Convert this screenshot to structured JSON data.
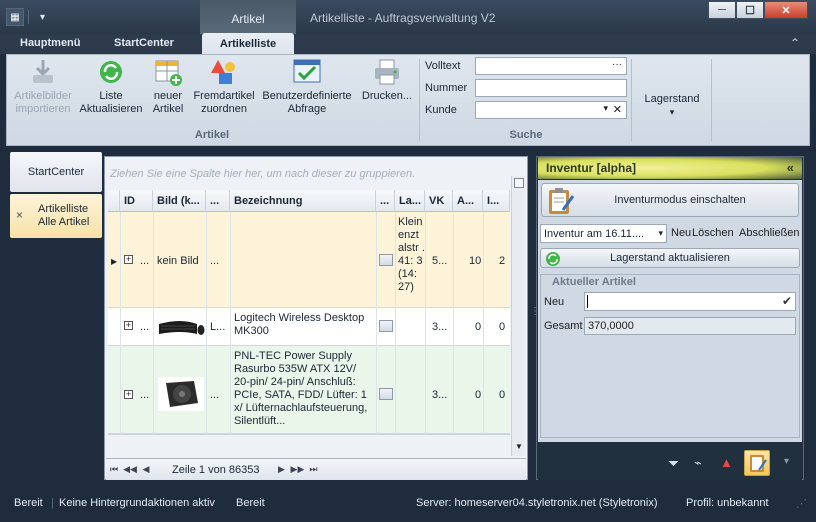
{
  "window": {
    "title": "Artikelliste - Auftragsverwaltung V2",
    "context_tab": "Artikel"
  },
  "tabs": [
    {
      "label": "Hauptmenü"
    },
    {
      "label": "StartCenter"
    },
    {
      "label": "Artikelliste"
    }
  ],
  "ribbon": {
    "groups": {
      "artikel": "Artikel",
      "suche": "Suche"
    },
    "buttons": [
      {
        "label": "Artikelbilder importieren",
        "icon": "import-images-icon",
        "enabled": false
      },
      {
        "label": "Liste Aktualisieren",
        "icon": "refresh-list-icon",
        "enabled": true
      },
      {
        "label": "neuer Artikel",
        "icon": "new-article-icon",
        "enabled": true
      },
      {
        "label": "Fremdartikel zuordnen",
        "icon": "assign-foreign-article-icon",
        "enabled": true
      },
      {
        "label": "Benutzerdefinierte Abfrage",
        "icon": "custom-query-icon",
        "enabled": true
      },
      {
        "label": "Drucken...",
        "icon": "printer-icon",
        "enabled": true
      }
    ],
    "search": {
      "volltext_label": "Volltext",
      "nummer_label": "Nummer",
      "kunde_label": "Kunde",
      "ellipsis": "···"
    },
    "lagerstand": "Lagerstand"
  },
  "sidebar": {
    "items": [
      {
        "label": "StartCenter"
      },
      {
        "label": "Artikelliste\nAlle Artikel",
        "line1": "Artikelliste",
        "line2": "Alle Artikel",
        "close": "×"
      }
    ]
  },
  "grid": {
    "group_hint": "Ziehen Sie eine Spalte hier her, um nach dieser zu gruppieren.",
    "columns": [
      "ID",
      "Bild (k...",
      "...",
      "Bezeichnung",
      "...",
      "La...",
      "VK",
      "A...",
      "I..."
    ],
    "rows": [
      {
        "id": "...",
        "bild": "kein Bild",
        "c3": "...",
        "bez": "",
        "lager": "Klein enzt alstr . 41: 3 (14: 27)",
        "vk": "5...",
        "a": "10",
        "i": "2"
      },
      {
        "id": "...",
        "bild": "",
        "c3": "L...",
        "bez": "Logitech Wireless Desktop MK300",
        "lager": "",
        "vk": "3...",
        "a": "0",
        "i": "0"
      },
      {
        "id": "...",
        "bild": "",
        "c3": "...",
        "bez": "PNL-TEC Power Supply Rasurbo 535W ATX 12V/ 20-pin/ 24-pin/ Anschluß: PCIe, SATA, FDD/ Lüfter: 1 x/ Lüfternachlaufsteuerung, Silentlüft...",
        "lager": "",
        "vk": "3...",
        "a": "0",
        "i": "0"
      }
    ],
    "pager": "Zeile 1 von 86353"
  },
  "inventur": {
    "title": "Inventur [alpha]",
    "mode_button": "Inventurmodus einschalten",
    "select_value": "Inventur am 16.11....",
    "neu": "Neu",
    "loeschen": "Löschen",
    "abschliessen": "Abschließen",
    "update_button": "Lagerstand aktualisieren",
    "section": "Aktueller Artikel",
    "neu_label": "Neu",
    "gesamt_label": "Gesamt",
    "gesamt_value": "370,0000"
  },
  "status": {
    "s1": "Bereit",
    "s2": "Keine Hintergrundaktionen aktiv",
    "s3": "Bereit",
    "server": "Server: homeserver04.styletronix.net (Styletronix)",
    "profil": "Profil: unbekannt"
  },
  "colors": {
    "accent": "#d8e05c",
    "selection": "#fdf3d8",
    "alt_row": "#e9f6e9"
  }
}
